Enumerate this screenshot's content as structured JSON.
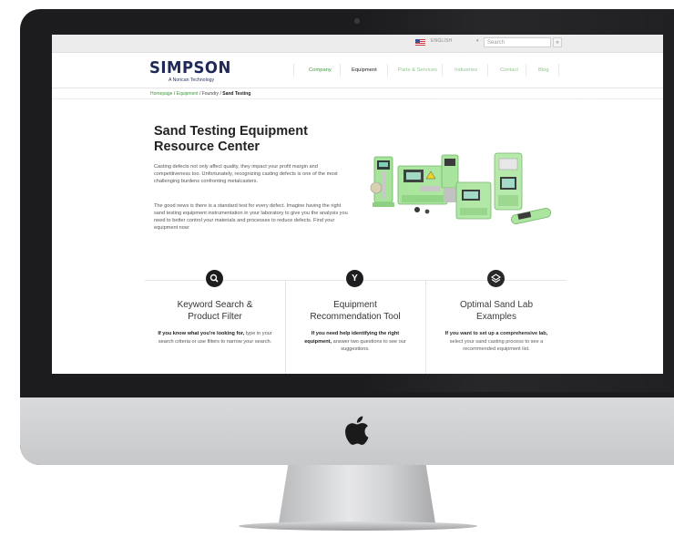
{
  "topbar": {
    "language": "ENGLISH",
    "search_placeholder": "Search",
    "search_button": "»"
  },
  "header": {
    "logo": "SIMPSON",
    "logo_sub": "A Norican Technology",
    "nav": [
      {
        "label": "Company"
      },
      {
        "label": "Equipment"
      },
      {
        "label": "Parts & Services"
      },
      {
        "label": "Industries"
      },
      {
        "label": "Contact"
      },
      {
        "label": "Blog"
      }
    ]
  },
  "breadcrumb": {
    "home": "Homepage",
    "equipment": "Equipment",
    "foundry": "Foundry",
    "current": "Sand Testing",
    "sep": "/"
  },
  "hero": {
    "title": "Sand Testing Equipment Resource Center",
    "p1": "Casting defects not only affect quality, they impact your profit margin and competitiveness too. Unfortunately, recognizing casting defects is one of the most challenging burdens confronting metalcasters.",
    "p2": "The good news is there is a standard test for every defect. Imagine having the right sand testing equipment instrumentation in your laboratory to give you the analysis you need to better control your materials and processes to reduce defects. Find your equipment now:"
  },
  "features": [
    {
      "icon": "search-icon",
      "title_1": "Keyword Search &",
      "title_2": "Product Filter",
      "desc_bold": "If you know what you're looking for,",
      "desc_rest": " type in your search criteria or use filters to narrow your search."
    },
    {
      "icon": "y-icon",
      "icon_glyph": "Y",
      "title_1": "Equipment",
      "title_2": "Recommendation Tool",
      "desc_bold": "If you need help identifying the right equipment,",
      "desc_rest": " answer two questions to see our suggestions."
    },
    {
      "icon": "layers-icon",
      "title_1": "Optimal Sand Lab",
      "title_2": "Examples",
      "desc_bold": "If you want to set up a comprehensive lab,",
      "desc_rest": " select your sand casting process to see a recommended equipment list."
    }
  ],
  "colors": {
    "brand_navy": "#1f2a59",
    "accent_green": "#3e9a3a",
    "equipment_green": "#9fe08f"
  }
}
